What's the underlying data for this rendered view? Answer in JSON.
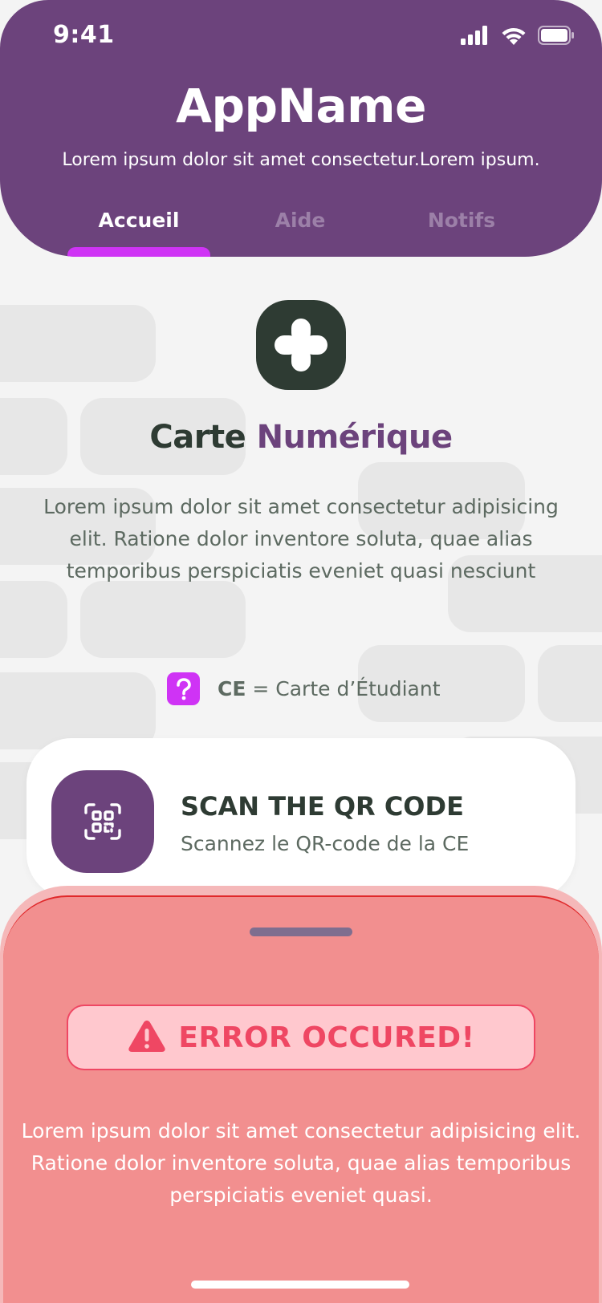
{
  "status_bar": {
    "time": "9:41"
  },
  "header": {
    "app_name": "AppName",
    "subtitle": "Lorem ipsum dolor sit amet consectetur.Lorem ipsum.",
    "tabs": [
      {
        "label": "Accueil",
        "active": true
      },
      {
        "label": "Aide",
        "active": false
      },
      {
        "label": "Notifs",
        "active": false
      }
    ]
  },
  "main": {
    "title_part1": "Carte ",
    "title_part2": "Numérique",
    "description": "Lorem ipsum dolor sit amet consectetur adipisicing elit. Ratione dolor inventore soluta, quae alias temporibus perspiciatis eveniet quasi nesciunt",
    "hint": {
      "abbr": "CE",
      "text": " = Carte d’Étudiant"
    },
    "scan_card": {
      "title": "SCAN THE QR CODE",
      "subtitle": "Scannez le QR-code de la CE"
    }
  },
  "sheet": {
    "error_label": "ERROR OCCURED!",
    "description": "Lorem ipsum dolor sit amet consectetur adipisicing elit. Ratione dolor inventore soluta, quae alias temporibus perspiciatis eveniet quasi."
  },
  "colors": {
    "brand_purple": "#6c437c",
    "accent_magenta": "#cf33f5",
    "dark_green": "#2e3b33",
    "error_red": "#ef4763",
    "sheet_bg": "#f28f8f"
  },
  "icons": {
    "signal": "cellular-signal-icon",
    "wifi": "wifi-icon",
    "battery": "battery-icon",
    "brand": "plus-petal-icon",
    "hint": "question-mark-icon",
    "scan": "qr-scan-icon",
    "error": "warning-triangle-icon"
  }
}
